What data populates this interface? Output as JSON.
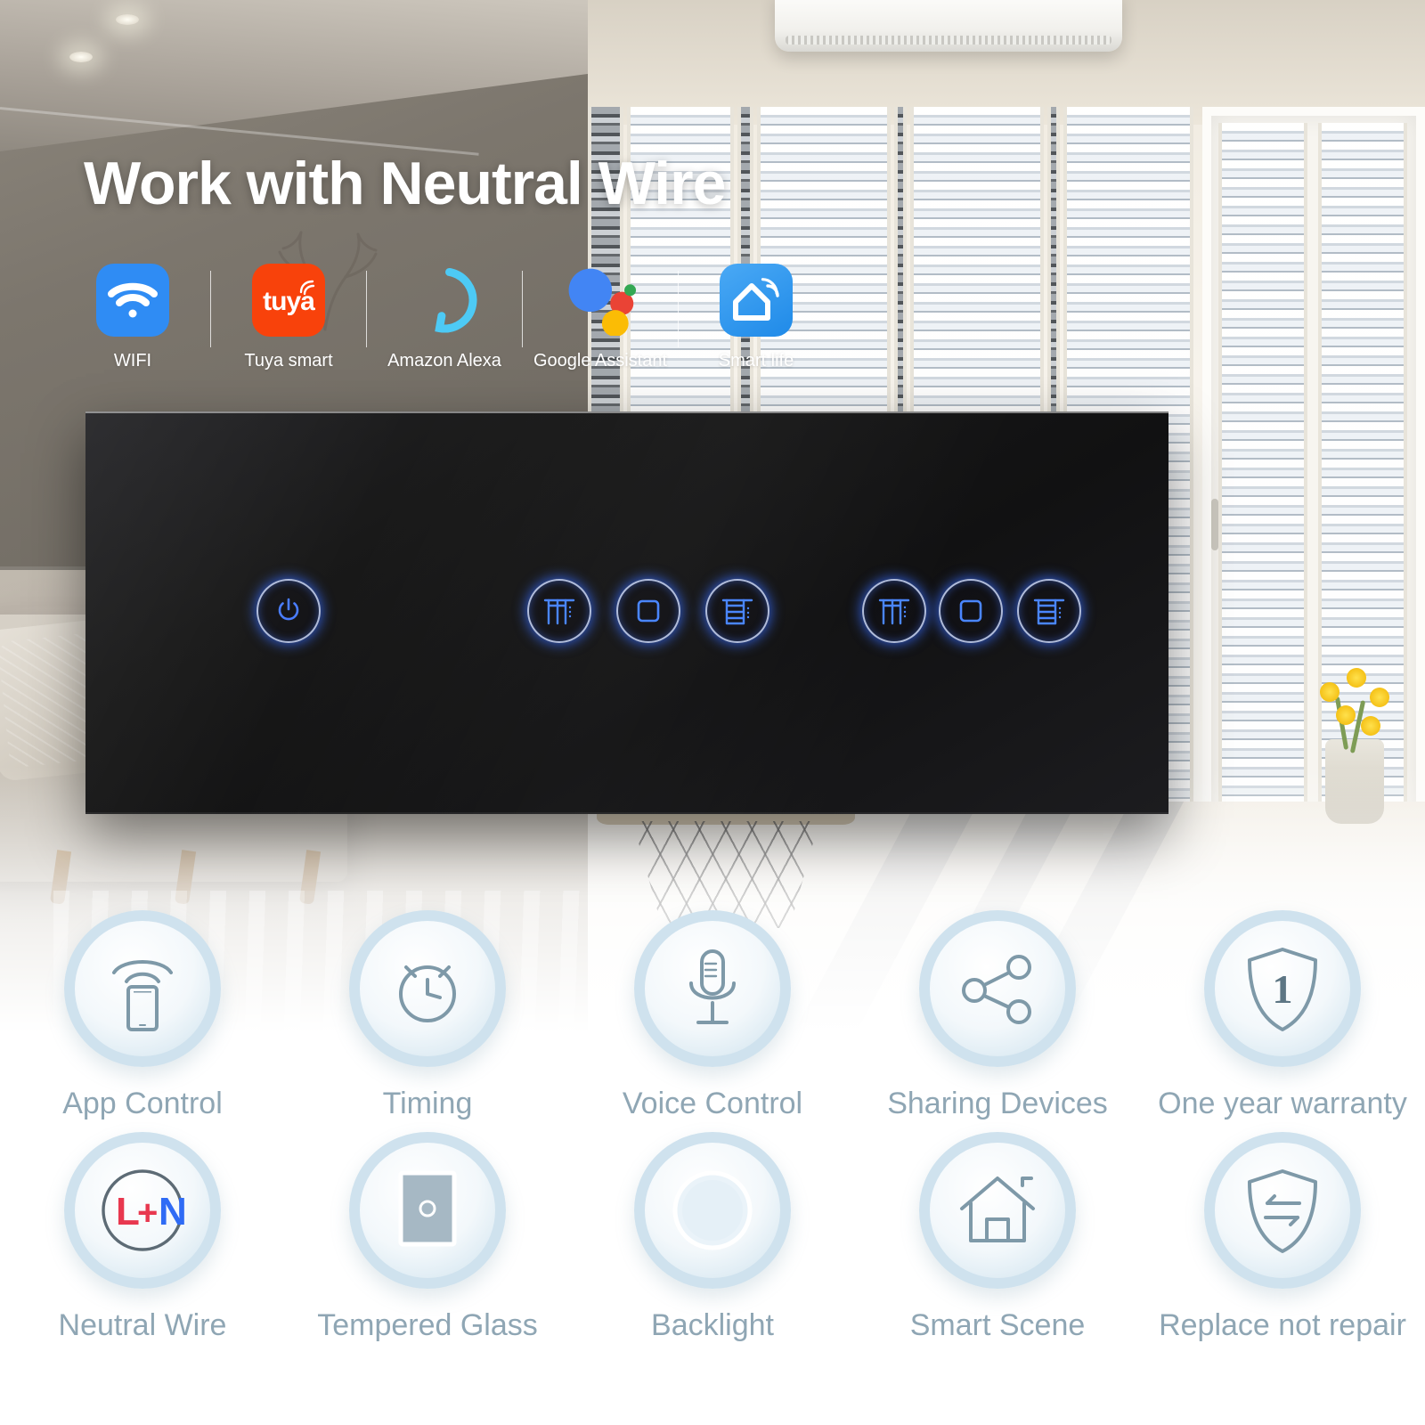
{
  "headline": "Work with Neutral Wire",
  "colors": {
    "wifi_tile": "#2f8cf4",
    "tuya_tile": "#f8420b",
    "alexa": "#4dcaf5",
    "google_blue": "#4285f4",
    "google_red": "#ea4335",
    "google_yellow": "#fbbc05",
    "google_green": "#34a853",
    "smartlife_tile": "#2f9bf0",
    "panel_glass": "#1a1a1c",
    "led_blue": "#3a6eff",
    "feature_text": "#8fa6b4",
    "neutral_L": "#e8384f",
    "neutral_N": "#2f6bf5"
  },
  "platforms": [
    {
      "label": "WIFI",
      "icon": "wifi-icon"
    },
    {
      "label": "Tuya smart",
      "icon": "tuya-logo-icon",
      "wordmark": "tuya"
    },
    {
      "label": "Amazon Alexa",
      "icon": "alexa-ring-icon"
    },
    {
      "label": "Google Assistant",
      "icon": "google-assistant-dots-icon"
    },
    {
      "label": "Smart life",
      "icon": "smart-life-house-icon"
    }
  ],
  "panel": {
    "gangs": [
      {
        "name": "left-gang-power",
        "buttons": [
          {
            "icon": "power-icon",
            "state": "on"
          }
        ]
      },
      {
        "name": "middle-gang-curtain",
        "buttons": [
          {
            "icon": "curtain-open-icon",
            "state": "on"
          },
          {
            "icon": "curtain-stop-icon",
            "state": "on"
          },
          {
            "icon": "curtain-close-icon",
            "state": "on"
          }
        ]
      },
      {
        "name": "right-gang-curtain",
        "buttons": [
          {
            "icon": "curtain-open-icon",
            "state": "on"
          },
          {
            "icon": "curtain-stop-icon",
            "state": "on"
          },
          {
            "icon": "curtain-close-icon",
            "state": "on"
          }
        ]
      }
    ]
  },
  "features": [
    {
      "label": "App Control",
      "icon": "phone-wifi-icon"
    },
    {
      "label": "Timing",
      "icon": "alarm-clock-icon"
    },
    {
      "label": "Voice Control",
      "icon": "microphone-icon"
    },
    {
      "label": "Sharing Devices",
      "icon": "share-nodes-icon"
    },
    {
      "label": "One year warranty",
      "icon": "shield-one-icon",
      "badge": "1"
    },
    {
      "label": "Neutral Wire",
      "icon": "neutral-wire-icon",
      "text_l": "L",
      "text_plus": "+",
      "text_n": "N"
    },
    {
      "label": "Tempered Glass",
      "icon": "glass-panel-icon"
    },
    {
      "label": "Backlight",
      "icon": "backlight-ring-icon"
    },
    {
      "label": "Smart Scene",
      "icon": "home-outline-icon"
    },
    {
      "label": "Replace not repair",
      "icon": "shield-exchange-icon"
    }
  ]
}
